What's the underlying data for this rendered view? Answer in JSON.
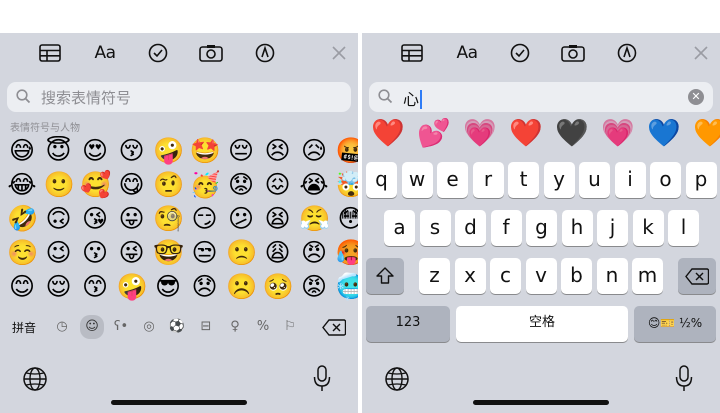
{
  "left": {
    "search": {
      "placeholder": "搜索表情符号"
    },
    "category_title": "表情符号与人物",
    "abc_label": "拼音",
    "emoji_rows": [
      [
        "😅",
        "😇",
        "😍",
        "😚",
        "🤪",
        "🤩",
        "😔",
        "😣",
        "😥",
        "🤬"
      ],
      [
        "😂",
        "🙂",
        "🥰",
        "😋",
        "🤨",
        "🥳",
        "😟",
        "😖",
        "😭",
        "🤯"
      ],
      [
        "🤣",
        "🙃",
        "😘",
        "😛",
        "🧐",
        "😏",
        "😕",
        "😫",
        "😤",
        "😳"
      ],
      [
        "☺️",
        "😉",
        "😗",
        "😜",
        "🤓",
        "😒",
        "🙁",
        "😩",
        "😠",
        "🥵"
      ],
      [
        "😊",
        "😌",
        "😙",
        "🤪",
        "😎",
        "😞",
        "☹️",
        "🥺",
        "😡",
        "🥶"
      ]
    ],
    "category_icons": [
      "clock-icon",
      "smiley-icon",
      "bear-icon",
      "food-icon",
      "ball-icon",
      "car-icon",
      "bulb-icon",
      "symbols-icon",
      "flag-icon"
    ]
  },
  "right": {
    "search": {
      "value": "心"
    },
    "suggestions": [
      "❤️",
      "💕",
      "💗",
      "❤️",
      "🖤",
      "💗",
      "💙",
      "🧡"
    ],
    "row1": [
      "q",
      "w",
      "e",
      "r",
      "t",
      "y",
      "u",
      "i",
      "o",
      "p"
    ],
    "row2": [
      "a",
      "s",
      "d",
      "f",
      "g",
      "h",
      "j",
      "k",
      "l"
    ],
    "row3": [
      "z",
      "x",
      "c",
      "v",
      "b",
      "n",
      "m"
    ],
    "num_label": "123",
    "space_label": "空格",
    "emoji_key": "😊🎫 ½%"
  }
}
